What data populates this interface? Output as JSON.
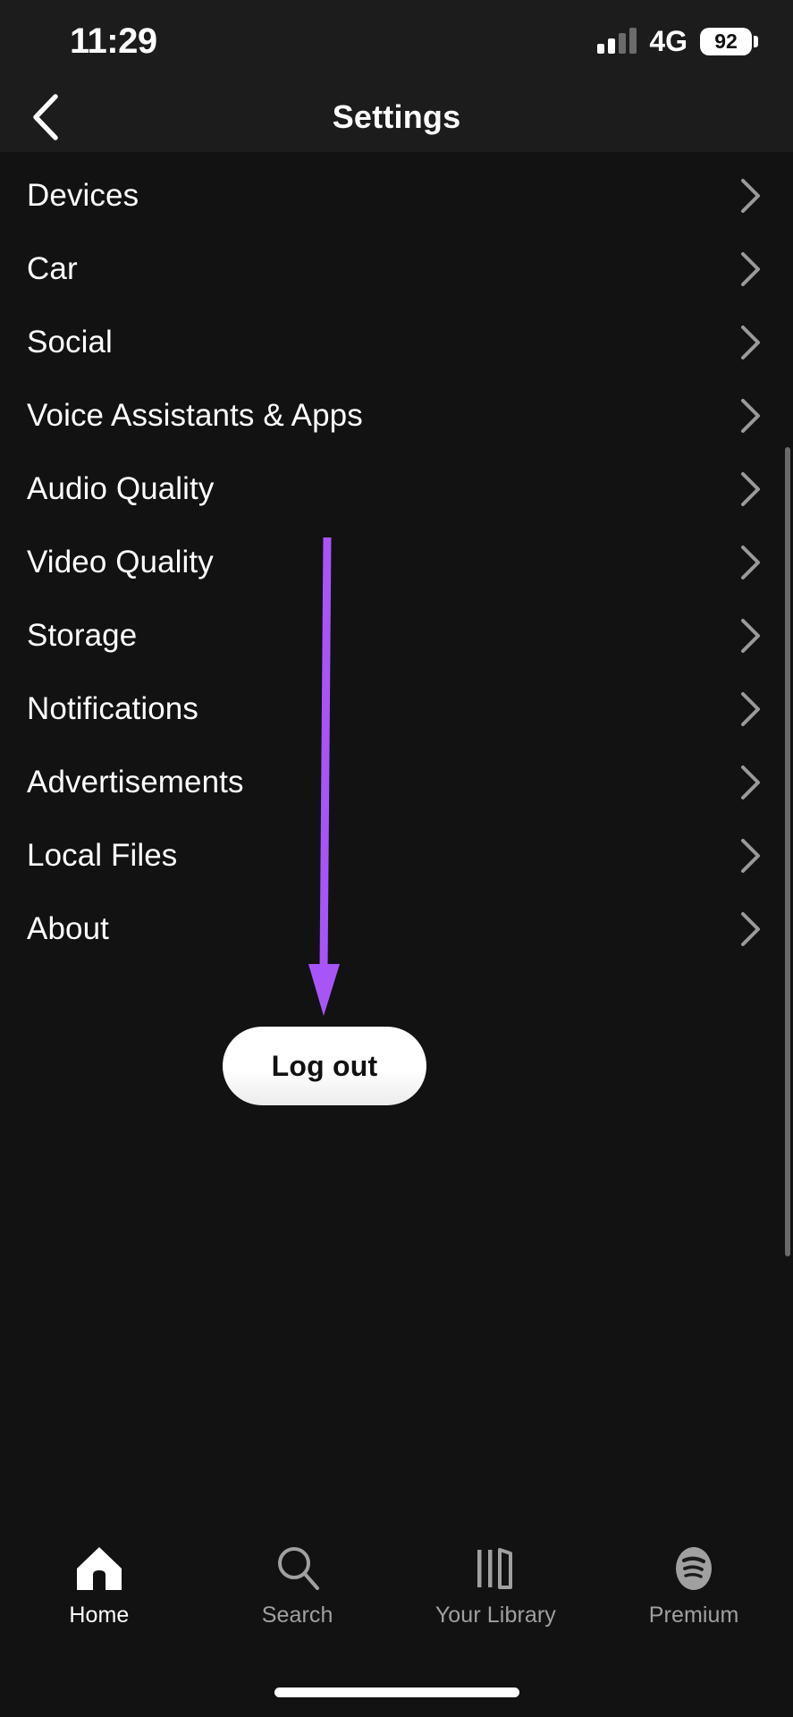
{
  "statusbar": {
    "time": "11:29",
    "network": "4G",
    "battery": "92",
    "signal_icon": "signal-bars-icon",
    "battery_icon": "battery-icon"
  },
  "header": {
    "title": "Settings",
    "back_icon": "chevron-left-icon"
  },
  "settings": {
    "items": [
      {
        "label": "Devices",
        "chevron": "chevron-right-icon"
      },
      {
        "label": "Car",
        "chevron": "chevron-right-icon"
      },
      {
        "label": "Social",
        "chevron": "chevron-right-icon"
      },
      {
        "label": "Voice Assistants & Apps",
        "chevron": "chevron-right-icon"
      },
      {
        "label": "Audio Quality",
        "chevron": "chevron-right-icon"
      },
      {
        "label": "Video Quality",
        "chevron": "chevron-right-icon"
      },
      {
        "label": "Storage",
        "chevron": "chevron-right-icon"
      },
      {
        "label": "Notifications",
        "chevron": "chevron-right-icon"
      },
      {
        "label": "Advertisements",
        "chevron": "chevron-right-icon"
      },
      {
        "label": "Local Files",
        "chevron": "chevron-right-icon"
      },
      {
        "label": "About",
        "chevron": "chevron-right-icon"
      }
    ]
  },
  "logout": {
    "label": "Log out"
  },
  "annotation": {
    "type": "down-arrow",
    "color": "#a855f7",
    "points_to": "Log out"
  },
  "bottomnav": {
    "items": [
      {
        "label": "Home",
        "icon": "home-icon",
        "active": true
      },
      {
        "label": "Search",
        "icon": "search-icon",
        "active": false
      },
      {
        "label": "Your Library",
        "icon": "library-icon",
        "active": false
      },
      {
        "label": "Premium",
        "icon": "spotify-icon",
        "active": false
      }
    ]
  },
  "colors": {
    "background": "#121212",
    "header_background": "#1c1c1c",
    "accent_annotation": "#a855f7",
    "text_primary": "#ffffff",
    "text_muted": "#a0a0a0",
    "chevron": "#9a9a9a"
  }
}
